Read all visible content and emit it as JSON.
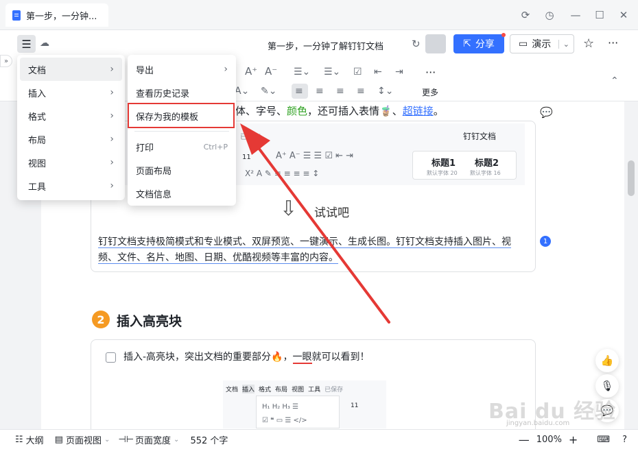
{
  "tab": {
    "title": "第一步，一分钟..."
  },
  "header": {
    "doc_title": "第一步，一分钟了解钉钉文档",
    "share_label": "分享",
    "present_label": "演示"
  },
  "toolbar": {
    "more_label": "更多",
    "font_size": "11"
  },
  "main_menu": {
    "items": [
      {
        "label": "文档"
      },
      {
        "label": "插入"
      },
      {
        "label": "格式"
      },
      {
        "label": "布局"
      },
      {
        "label": "视图"
      },
      {
        "label": "工具"
      }
    ]
  },
  "sub_menu": {
    "export": "导出",
    "history": "查看历史记录",
    "save_template": "保存为我的模板",
    "print": "打印",
    "print_shortcut": "Ctrl+P",
    "page_layout": "页面布局",
    "doc_info": "文档信息"
  },
  "content": {
    "line1_a": "体、字号、",
    "line1_color": "颜色",
    "line1_b": "，还可插入表情",
    "line1_link": "超链接",
    "line1_end": "。",
    "inner_saved": "已保存",
    "inner_title": "钉钉文档",
    "inner_font_size": "11",
    "heading1": "标题1",
    "heading1_sub": "默认字体 20",
    "heading2": "标题2",
    "heading2_sub": "默认字体 16",
    "try_it": "试试吧",
    "paragraph": "钉钉文档支持极简模式和专业模式、双屏预览、一键演示、生成长图。钉钉文档支持插入图片、视频、文件、名片、地图、日期、优酷视频等丰富的内容。",
    "comment_count": "1",
    "section_num": "2",
    "section_title": "插入高亮块",
    "checkbox_text_a": "插入-高亮块，突出文档的重要部分",
    "checkbox_text_b": "，",
    "checkbox_text_u": "一眼",
    "checkbox_text_c": "就可以看到！",
    "mini_menu": [
      "文档",
      "插入",
      "格式",
      "布局",
      "视图",
      "工具"
    ],
    "mini_saved": "已保存",
    "mini_font": "11"
  },
  "status": {
    "outline": "大纲",
    "page_view": "页面视图",
    "page_width": "页面宽度",
    "word_count": "552 个字",
    "zoom": "100%"
  },
  "watermark": {
    "brand": "Bai du 经验",
    "url": "jingyan.baidu.com"
  },
  "colors": {
    "accent": "#3370ff",
    "highlight_border": "#e53935",
    "arrow": "#e53935"
  }
}
